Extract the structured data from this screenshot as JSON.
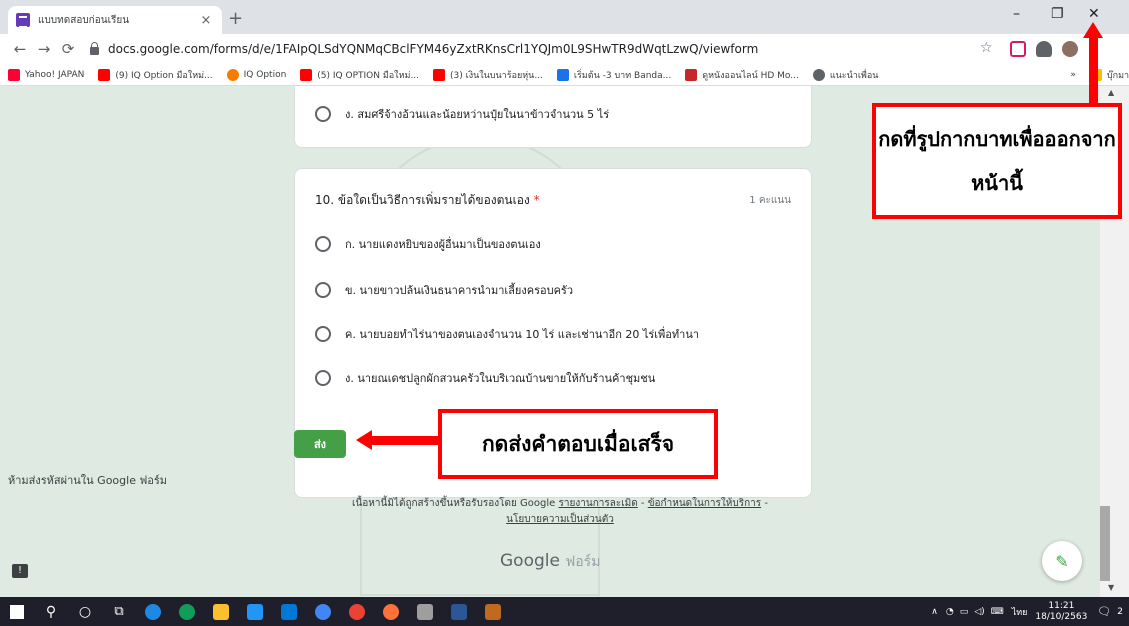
{
  "browser": {
    "tab_title": "แบบทดสอบก่อนเรียน",
    "tab_close": "×",
    "new_tab": "+",
    "url": "docs.google.com/forms/d/e/1FAIpQLSdYQNMqCBclFYM46yZxtRKnsCrl1YQJm0L9SHwTR9dWqtLzwQ/viewform",
    "win_minimize": "–",
    "win_restore": "❐",
    "win_close": "✕",
    "bookmarks": [
      {
        "label": "Yahoo! JAPAN",
        "color": "#ff0033"
      },
      {
        "label": "(9) IQ Option มือใหม่...",
        "color": "#ff0000"
      },
      {
        "label": "IQ Option",
        "color": "#f57c00"
      },
      {
        "label": "(5) IQ OPTION มือใหม่...",
        "color": "#ff0000"
      },
      {
        "label": "(3) เงินในบนาร้อยหุ่น...",
        "color": "#ff0000"
      },
      {
        "label": "เริ่มต้น -3 บาท Banda...",
        "color": "#1a73e8"
      },
      {
        "label": "ดูหนังออนไลน์ HD Mo...",
        "color": "#c62828"
      },
      {
        "label": "แนะนำเพื่อน",
        "color": "#5f6368"
      }
    ],
    "bookmarks_more": "»",
    "bookmarks_folder": "บุ๊กมาร์กอื่น"
  },
  "form": {
    "prev_option": "ง. สมศรีจ้างอ้วนและน้อยหว่านปุ๋ยในนาข้าวจำนวน 5 ไร่",
    "question": "10. ข้อใดเป็นวิธีการเพิ่มรายได้ของตนเอง",
    "required_mark": "*",
    "points": "1 คะแนน",
    "options": [
      "ก. นายแดงหยิบของผู้อื่นมาเป็นของตนเอง",
      "ข. นายขาวปล้นเงินธนาคารนำมาเลี้ยงครอบครัว",
      "ค. นายบอยทำไร่นาของตนเองจำนวน 10 ไร่ และเช่านาอีก 20 ไร่เพื่อทำนา",
      "ง. นายณเดชปลูกผักสวนครัวในบริเวณบ้านขายให้กับร้านค้าชุมชน"
    ],
    "submit_label": "ส่ง",
    "password_note": "ห้ามส่งรหัสผ่านใน Google ฟอร์ม",
    "footer_text": "เนื้อหานี้มิได้ถูกสร้างขึ้นหรือรับรองโดย Google",
    "footer_links": [
      "รายงานการละเมิด",
      "ข้อกำหนดในการให้บริการ",
      "นโยบายความเป็นส่วนตัว"
    ],
    "footer_sep": " - ",
    "brand_google": "Google",
    "brand_forms": "ฟอร์ม",
    "feedback_icon": "!"
  },
  "annotations": {
    "close_hint": "กดที่รูปกากบาทเพื่อออกจากหน้านี้",
    "submit_hint": "กดส่งคำตอบเมื่อเสร็จ"
  },
  "taskbar": {
    "lang": "ไทย",
    "time": "11:21",
    "date": "18/10/2563",
    "notif_count": "2"
  },
  "colors": {
    "accent": "#43a047",
    "annotation": "#ff0000"
  }
}
